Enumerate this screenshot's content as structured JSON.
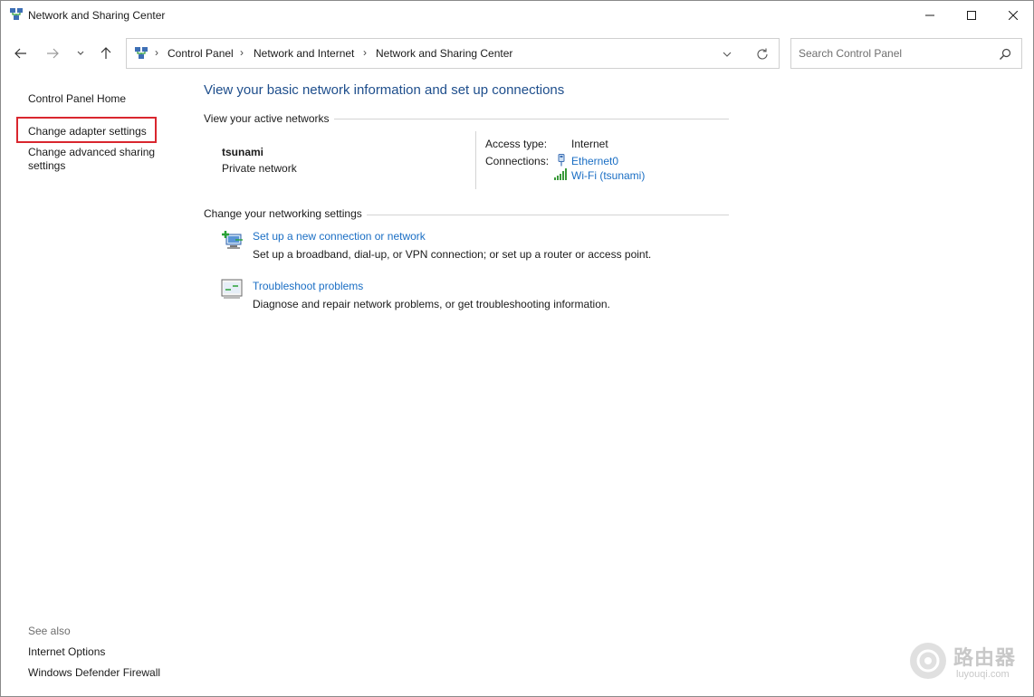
{
  "window": {
    "title": "Network and Sharing Center"
  },
  "address": {
    "crumbs": [
      "Control Panel",
      "Network and Internet",
      "Network and Sharing Center"
    ],
    "separator": "›"
  },
  "search": {
    "placeholder": "Search Control Panel"
  },
  "sidebar": {
    "home": "Control Panel Home",
    "adapter": "Change adapter settings",
    "advanced_line1": "Change advanced sharing",
    "advanced_line2": "settings",
    "see_also": "See also",
    "internet_options": "Internet Options",
    "firewall": "Windows Defender Firewall"
  },
  "main": {
    "heading": "View your basic network information and set up connections",
    "active_networks_label": "View your active networks",
    "network": {
      "name": "tsunami",
      "category": "Private network",
      "access_type_label": "Access type:",
      "access_type_value": "Internet",
      "connections_label": "Connections:",
      "connection1": "Ethernet0",
      "connection2": "Wi-Fi (tsunami)"
    },
    "change_settings_label": "Change your networking settings",
    "tasks": [
      {
        "link": "Set up a new connection or network",
        "desc": "Set up a broadband, dial-up, or VPN connection; or set up a router or access point."
      },
      {
        "link": "Troubleshoot problems",
        "desc": "Diagnose and repair network problems, or get troubleshooting information."
      }
    ]
  },
  "watermark": {
    "text": "路由器",
    "sub": "luyouqi.com"
  },
  "colors": {
    "heading": "#1e4e8c",
    "link": "#1a6ec4",
    "highlight": "#d9262e"
  }
}
